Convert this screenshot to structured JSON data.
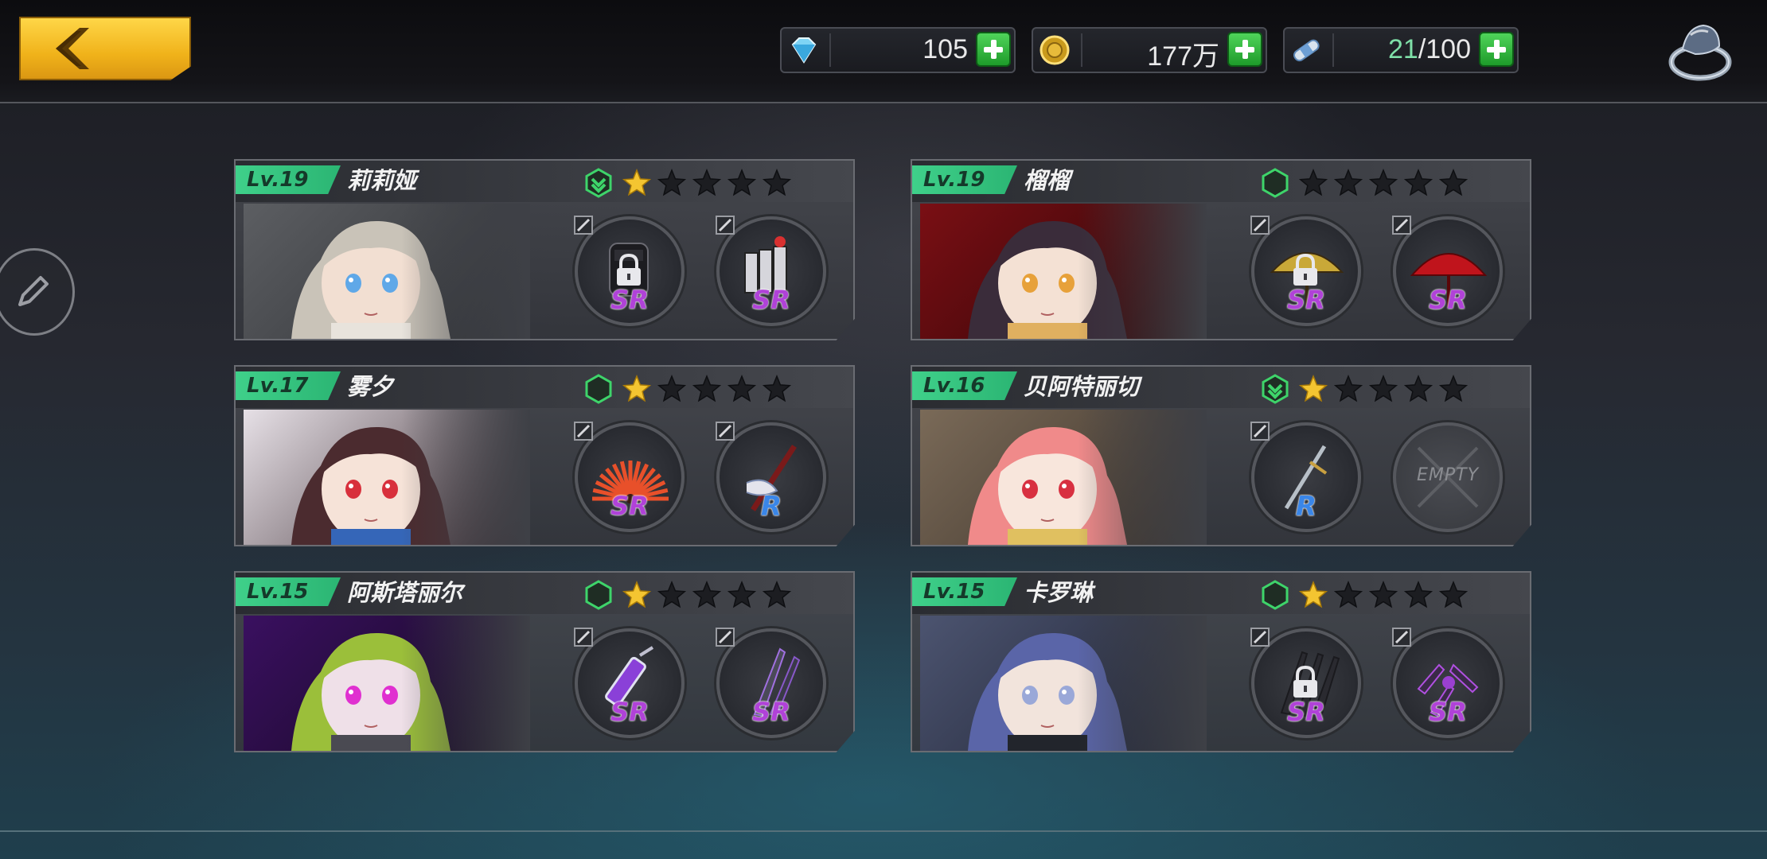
{
  "resources": [
    {
      "icon": "diamond-icon",
      "value": "105",
      "highlight": ""
    },
    {
      "icon": "gold-coin-icon",
      "value": "177万",
      "highlight": ""
    },
    {
      "icon": "stamina-bandage-icon",
      "value": "/100",
      "highlight": "21"
    }
  ],
  "characters": [
    {
      "level": "Lv.19",
      "name": "莉莉娅",
      "stars": 1,
      "class_icon": "chevron-hex-icon",
      "slots": [
        {
          "rarity": "SR",
          "locked": true,
          "item": "gauntlet"
        },
        {
          "rarity": "SR",
          "locked": false,
          "item": "gatling-gun"
        }
      ]
    },
    {
      "level": "Lv.19",
      "name": "榴榴",
      "stars": 0,
      "class_icon": "hex-icon",
      "slots": [
        {
          "rarity": "SR",
          "locked": true,
          "item": "yellow-umbrella"
        },
        {
          "rarity": "SR",
          "locked": false,
          "item": "red-umbrella"
        }
      ]
    },
    {
      "level": "Lv.17",
      "name": "雾夕",
      "stars": 1,
      "class_icon": "hex-icon",
      "slots": [
        {
          "rarity": "SR",
          "locked": false,
          "item": "folding-fan"
        },
        {
          "rarity": "R",
          "locked": false,
          "item": "staff"
        }
      ]
    },
    {
      "level": "Lv.16",
      "name": "贝阿特丽切",
      "stars": 1,
      "class_icon": "chevron-hex-icon",
      "slots": [
        {
          "rarity": "R",
          "locked": false,
          "item": "sword"
        },
        {
          "rarity": "",
          "locked": false,
          "item": "empty",
          "label": "EMPTY"
        }
      ]
    },
    {
      "level": "Lv.15",
      "name": "阿斯塔丽尔",
      "stars": 1,
      "class_icon": "hex-icon",
      "slots": [
        {
          "rarity": "SR",
          "locked": false,
          "item": "syringe"
        },
        {
          "rarity": "SR",
          "locked": false,
          "item": "blades"
        }
      ]
    },
    {
      "level": "Lv.15",
      "name": "卡罗琳",
      "stars": 1,
      "class_icon": "hex-icon",
      "slots": [
        {
          "rarity": "SR",
          "locked": true,
          "item": "claws"
        },
        {
          "rarity": "SR",
          "locked": false,
          "item": "claws-purple"
        }
      ]
    }
  ],
  "colors": {
    "level_badge": "#2bb573",
    "star_filled": "#f4c531",
    "star_empty": "#1c1d21",
    "sr": "#b042d8",
    "r": "#3a86e8",
    "accent": "#f0b21a"
  }
}
